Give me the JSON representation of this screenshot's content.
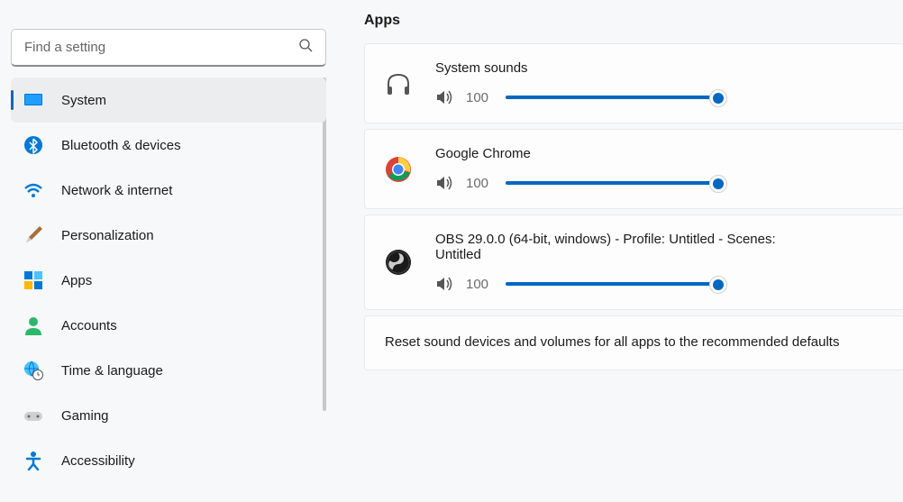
{
  "search": {
    "placeholder": "Find a setting"
  },
  "sidebar": {
    "items": [
      {
        "label": "System"
      },
      {
        "label": "Bluetooth & devices"
      },
      {
        "label": "Network & internet"
      },
      {
        "label": "Personalization"
      },
      {
        "label": "Apps"
      },
      {
        "label": "Accounts"
      },
      {
        "label": "Time & language"
      },
      {
        "label": "Gaming"
      },
      {
        "label": "Accessibility"
      }
    ]
  },
  "content": {
    "section_title": "Apps",
    "apps": [
      {
        "name": "System sounds",
        "volume": "100"
      },
      {
        "name": "Google Chrome",
        "volume": "100"
      },
      {
        "name": "OBS 29.0.0 (64-bit, windows) - Profile: Untitled - Scenes: Untitled",
        "volume": "100"
      }
    ],
    "reset_text": "Reset sound devices and volumes for all apps to the recommended defaults"
  }
}
